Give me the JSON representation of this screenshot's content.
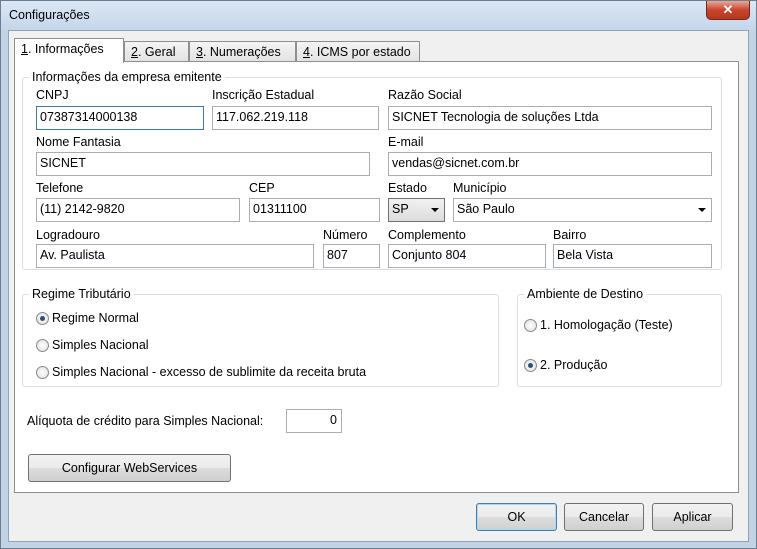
{
  "window": {
    "title": "Configurações",
    "close_glyph": "✕"
  },
  "tabs": [
    {
      "hotkey": "1",
      "label": ". Informações"
    },
    {
      "hotkey": "2",
      "label": ". Geral"
    },
    {
      "hotkey": "3",
      "label": ". Numerações"
    },
    {
      "hotkey": "4",
      "label": ". ICMS por estado"
    }
  ],
  "empresa": {
    "legend": "Informações da empresa emitente",
    "cnpj": {
      "label": "CNPJ",
      "value": "07387314000138"
    },
    "ie": {
      "label": "Inscrição Estadual",
      "value": "117.062.219.118"
    },
    "razao": {
      "label": "Razão Social",
      "value": "SICNET Tecnologia de soluções Ltda"
    },
    "fantasia": {
      "label": "Nome Fantasia",
      "value": "SICNET"
    },
    "email": {
      "label": "E-mail",
      "value": "vendas@sicnet.com.br"
    },
    "telefone": {
      "label": "Telefone",
      "value": "(11) 2142-9820"
    },
    "cep": {
      "label": "CEP",
      "value": "01311100"
    },
    "estado": {
      "label": "Estado",
      "value": "SP"
    },
    "municipio": {
      "label": "Município",
      "value": "São Paulo"
    },
    "logradouro": {
      "label": "Logradouro",
      "value": "Av. Paulista"
    },
    "numero": {
      "label": "Número",
      "value": "807"
    },
    "complemento": {
      "label": "Complemento",
      "value": "Conjunto 804"
    },
    "bairro": {
      "label": "Bairro",
      "value": "Bela Vista"
    }
  },
  "regime": {
    "legend": "Regime Tributário",
    "options": [
      {
        "label": "Regime Normal",
        "checked": true
      },
      {
        "label": "Simples Nacional",
        "checked": false
      },
      {
        "label": "Simples Nacional - excesso de sublimite da receita bruta",
        "checked": false
      }
    ]
  },
  "ambiente": {
    "legend": "Ambiente de Destino",
    "options": [
      {
        "label": "1. Homologação (Teste)",
        "checked": false
      },
      {
        "label": "2. Produção",
        "checked": true
      }
    ]
  },
  "aliquota": {
    "label": "Alíquota de crédito para Simples Nacional:",
    "value": "0"
  },
  "buttons": {
    "webservices": "Configurar WebServices",
    "ok": "OK",
    "cancel": "Cancelar",
    "apply": "Aplicar"
  }
}
